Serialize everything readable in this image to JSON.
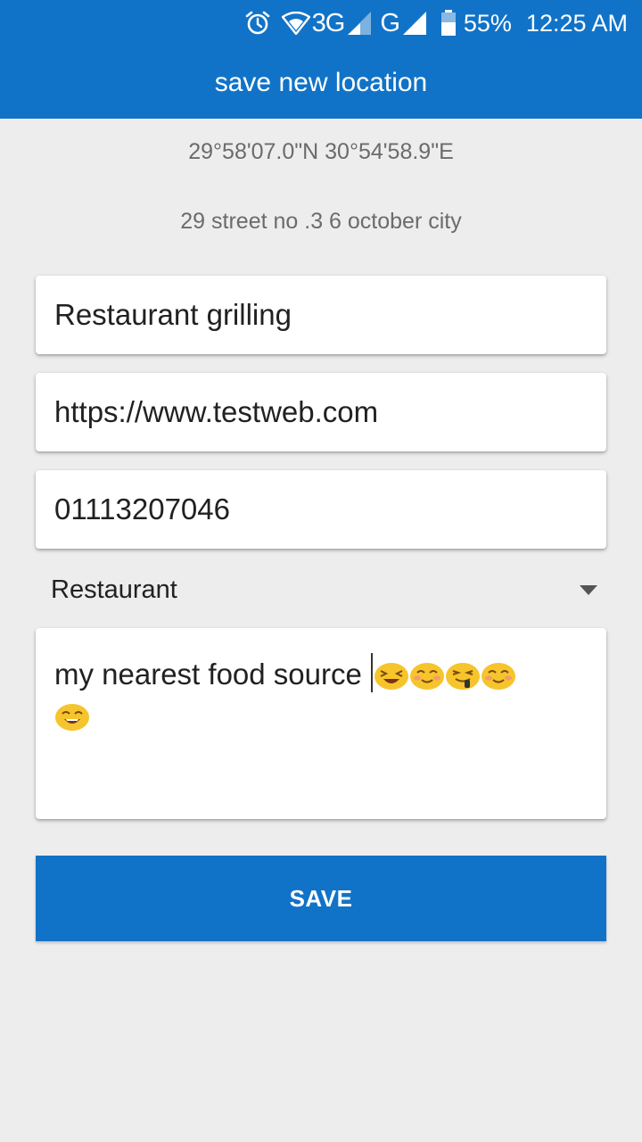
{
  "status_bar": {
    "alarm_icon": "alarm-clock-icon",
    "wifi_icon": "wifi-icon",
    "network_3g": "3G",
    "network_g": "G",
    "battery_icon": "battery-icon",
    "battery_percent": "55%",
    "time": "12:25 AM"
  },
  "app_bar": {
    "title": "save new location"
  },
  "location": {
    "coordinates": "29°58'07.0\"N 30°54'58.9\"E",
    "address": "29 street no .3 6 october city"
  },
  "form": {
    "name_value": "Restaurant grilling",
    "website_value": "https://www.testweb.com",
    "phone_value": "01113207046",
    "category_selected": "Restaurant",
    "notes_text": "my nearest food source ",
    "notes_emojis": [
      "squinting-face-emoji",
      "smiling-face-emoji",
      "yum-face-emoji",
      "smiling-face-emoji",
      "grinning-face-emoji"
    ]
  },
  "actions": {
    "save_label": "SAVE"
  },
  "colors": {
    "primary": "#1173c7",
    "background": "#ededed",
    "emoji_yellow": "#f6c42c"
  }
}
